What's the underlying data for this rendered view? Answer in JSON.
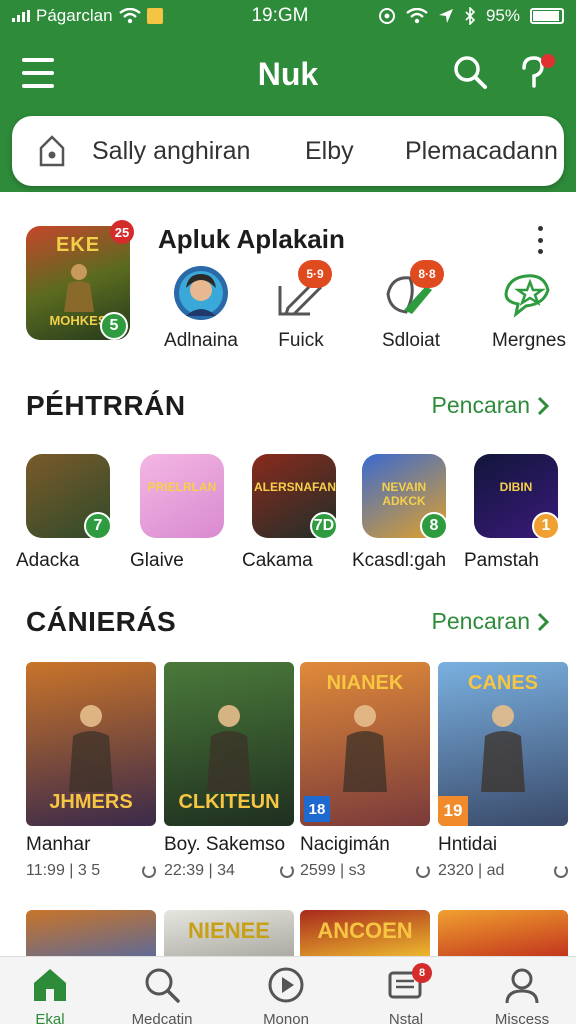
{
  "status_bar": {
    "carrier": "Págarclan",
    "time": "19:GM",
    "battery": "95%"
  },
  "header": {
    "title": "Nuk"
  },
  "tabs": [
    "Sally anghiran",
    "Elby",
    "Plemacadann"
  ],
  "featured": {
    "name": "Apluk Aplakain",
    "thumb_title": "EKE",
    "thumb_subtitle": "MOHKES",
    "badge_top": "25",
    "badge_bottom": "5",
    "actions": [
      {
        "label": "Adlnaina",
        "icon": "avatar-icon"
      },
      {
        "label": "Fuick",
        "icon": "edit-icon",
        "badge": "5·9"
      },
      {
        "label": "Sdloiat",
        "icon": "leaf-icon",
        "badge": "8·8"
      },
      {
        "label": "Mergnes",
        "icon": "star-icon"
      }
    ]
  },
  "section1": {
    "title": "PÉHTRRÁN",
    "more": "Pencaran"
  },
  "apps": [
    {
      "label": "Adacka",
      "badge": "7",
      "badge_color": "#2e9b3e",
      "c1": "#7a5a2a",
      "c2": "#2f4a2a",
      "art": ""
    },
    {
      "label": "Glaive",
      "badge": "",
      "badge_color": "",
      "c1": "#f3b7e3",
      "c2": "#d98ad0",
      "art": "PRIELRLAN"
    },
    {
      "label": "Cakama",
      "badge": "7D",
      "badge_color": "#2e9b3e",
      "c1": "#8a2a1c",
      "c2": "#1f2f2a",
      "art": "ALERSNAFAN"
    },
    {
      "label": "Kcasdl:gah",
      "badge": "8",
      "badge_color": "#2e9b3e",
      "c1": "#3a6ad0",
      "c2": "#e0a12a",
      "art": "NEVAIN ADKCK"
    },
    {
      "label": "Pamstah",
      "badge": "1",
      "badge_color": "#f0a030",
      "c1": "#11163a",
      "c2": "#3a1a7a",
      "art": "DIBIN"
    }
  ],
  "section2": {
    "title": "CÁNIERÁS",
    "more": "Pencaran"
  },
  "cards": [
    {
      "name": "Manhar",
      "meta": "11:99 | 3 5",
      "art_top": "",
      "art_bottom": "JHMERS",
      "c1": "#c9742a",
      "c2": "#3a2a4a"
    },
    {
      "name": "Boy. Sakemso",
      "meta": "22:39 | 34",
      "art_top": "",
      "art_bottom": "CLKITEUN",
      "c1": "#4a7a3a",
      "c2": "#1f2f20"
    },
    {
      "name": "Nacigimán",
      "meta": "2599 | s3",
      "art_top": "NIANEK",
      "art_bottom": "",
      "c1": "#e08a3a",
      "c2": "#7a3a3a"
    },
    {
      "name": "Hntidai",
      "meta": "2320 | ad",
      "art_top": "CANES",
      "art_bottom": "",
      "c1": "#7ab0e0",
      "c2": "#3a4a6a"
    }
  ],
  "card_badges": [
    {
      "text": "18",
      "bg": "#1f6ad0"
    },
    {
      "text": "19",
      "bg": "#f08a2a"
    }
  ],
  "row3": [
    {
      "text": "",
      "c1": "#c9742a",
      "c2": "#5a6a9a"
    },
    {
      "text": "NIENEE",
      "c1": "#e6e6e0",
      "c2": "#a8a8a0"
    },
    {
      "text": "ANCOEN",
      "c1": "#a82a1c",
      "c2": "#f0c030"
    },
    {
      "text": "",
      "c1": "#f0a030",
      "c2": "#c0301c"
    }
  ],
  "bottom_nav": [
    {
      "label": "Ekal",
      "icon": "home-icon",
      "active": true
    },
    {
      "label": "Medcatin",
      "icon": "search-icon",
      "active": false
    },
    {
      "label": "Monon",
      "icon": "play-icon",
      "active": false
    },
    {
      "label": "Nstal",
      "icon": "updates-icon",
      "active": false,
      "badge": "8"
    },
    {
      "label": "Miscess",
      "icon": "profile-icon",
      "active": false
    }
  ],
  "colors": {
    "brand": "#2e8b3a",
    "badge_red": "#d42b2b"
  }
}
